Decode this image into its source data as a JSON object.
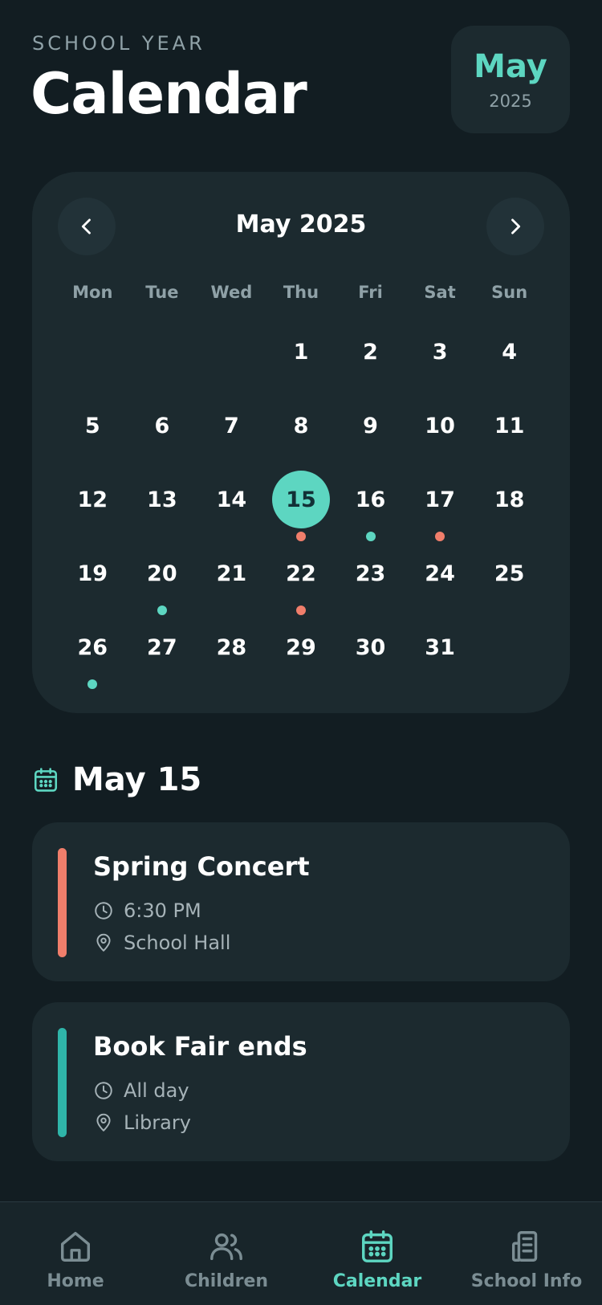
{
  "header": {
    "subtitle": "SCHOOL YEAR",
    "title": "Calendar"
  },
  "month_badge": {
    "month": "May",
    "year": "2025"
  },
  "calendar": {
    "title": "May 2025",
    "weekdays": [
      "Mon",
      "Tue",
      "Wed",
      "Thu",
      "Fri",
      "Sat",
      "Sun"
    ],
    "selected_day": 15,
    "weeks": [
      [
        null,
        null,
        null,
        1,
        2,
        3,
        4
      ],
      [
        5,
        6,
        7,
        8,
        9,
        10,
        11
      ],
      [
        12,
        13,
        14,
        15,
        16,
        17,
        18
      ],
      [
        19,
        20,
        21,
        22,
        23,
        24,
        25
      ],
      [
        26,
        27,
        28,
        29,
        30,
        31,
        null
      ]
    ],
    "event_dots": {
      "15": "coral",
      "16": "teal",
      "17": "coral",
      "20": "teal",
      "22": "coral",
      "26": "teal"
    }
  },
  "selected_section": {
    "icon": "calendar-icon",
    "title": "May 15"
  },
  "events": [
    {
      "title": "Spring Concert",
      "time": "6:30 PM",
      "location": "School Hall",
      "color": "#f07e6b"
    },
    {
      "title": "Book Fair ends",
      "time": "All day",
      "location": "Library",
      "color": "#2fb5a9"
    }
  ],
  "colors": {
    "accent": "#5dd6c1",
    "coral": "#f07e6b",
    "teal_bar": "#2fb5a9",
    "background": "#121d22",
    "card": "#1c2a2f"
  },
  "tabbar": {
    "tabs": [
      {
        "label": "Home",
        "icon": "home-icon",
        "active": false
      },
      {
        "label": "Children",
        "icon": "users-icon",
        "active": false
      },
      {
        "label": "Calendar",
        "icon": "calendar-icon",
        "active": true
      },
      {
        "label": "School Info",
        "icon": "building-icon",
        "active": false
      }
    ]
  }
}
